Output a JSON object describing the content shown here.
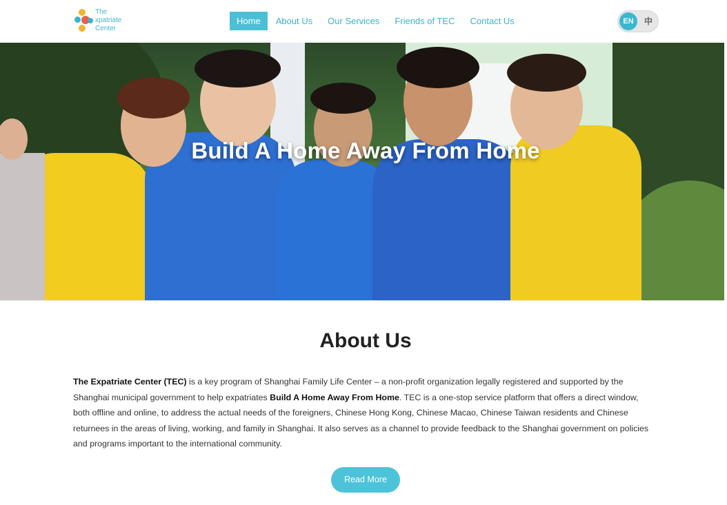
{
  "logo": {
    "line1": "The",
    "line2": "xpatriate",
    "line3": "Center"
  },
  "nav": {
    "items": [
      {
        "label": "Home",
        "active": true
      },
      {
        "label": "About Us",
        "active": false
      },
      {
        "label": "Our Services",
        "active": false
      },
      {
        "label": "Friends of TEC",
        "active": false
      },
      {
        "label": "Contact Us",
        "active": false
      }
    ]
  },
  "lang": {
    "en": "EN",
    "zh": "中",
    "selected": "EN"
  },
  "hero": {
    "title": "Build A Home Away From Home"
  },
  "about": {
    "title": "About Us",
    "p1_bold": "The Expatriate Center (TEC)",
    "p1_text": " is a key program of Shanghai Family Life Center – a non-profit organization legally registered and supported by the Shanghai municipal government to help expatriates ",
    "p2_bold": "Build A Home Away From Home",
    "p2_text": ". TEC is a one-stop service platform that offers a direct window, both offline and online, to address the actual needs of the foreigners, Chinese Hong Kong, Chinese Macao, Chinese Taiwan residents and Chinese returnees in the areas of living, working, and family in Shanghai. It also serves as a channel to provide feedback to the Shanghai government on policies and programs important to the international community.",
    "read_more": "Read More"
  },
  "colors": {
    "accent": "#4cbfd6",
    "nav_text": "#3bb3cc"
  }
}
